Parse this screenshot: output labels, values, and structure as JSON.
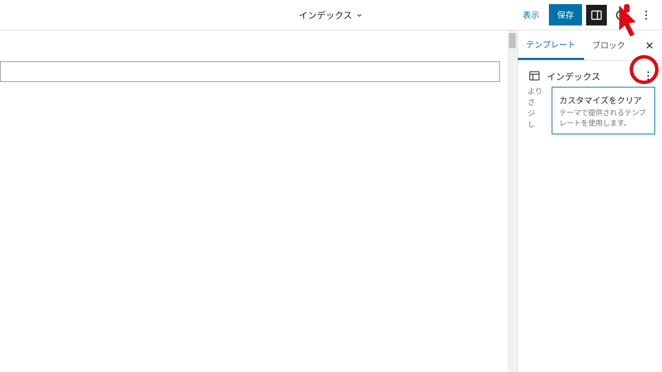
{
  "topbar": {
    "title": "インデックス",
    "view_label": "表示",
    "save_label": "保存"
  },
  "sidebar": {
    "tabs": {
      "template": "テンプレート",
      "block": "ブロック"
    },
    "template": {
      "name": "インデックス",
      "desc_partial_left": "より\nさ\nジ\nし"
    },
    "popover": {
      "title": "カスタマイズをクリア",
      "sub": "テーマで提供されるテンプレートを使用します。"
    }
  }
}
